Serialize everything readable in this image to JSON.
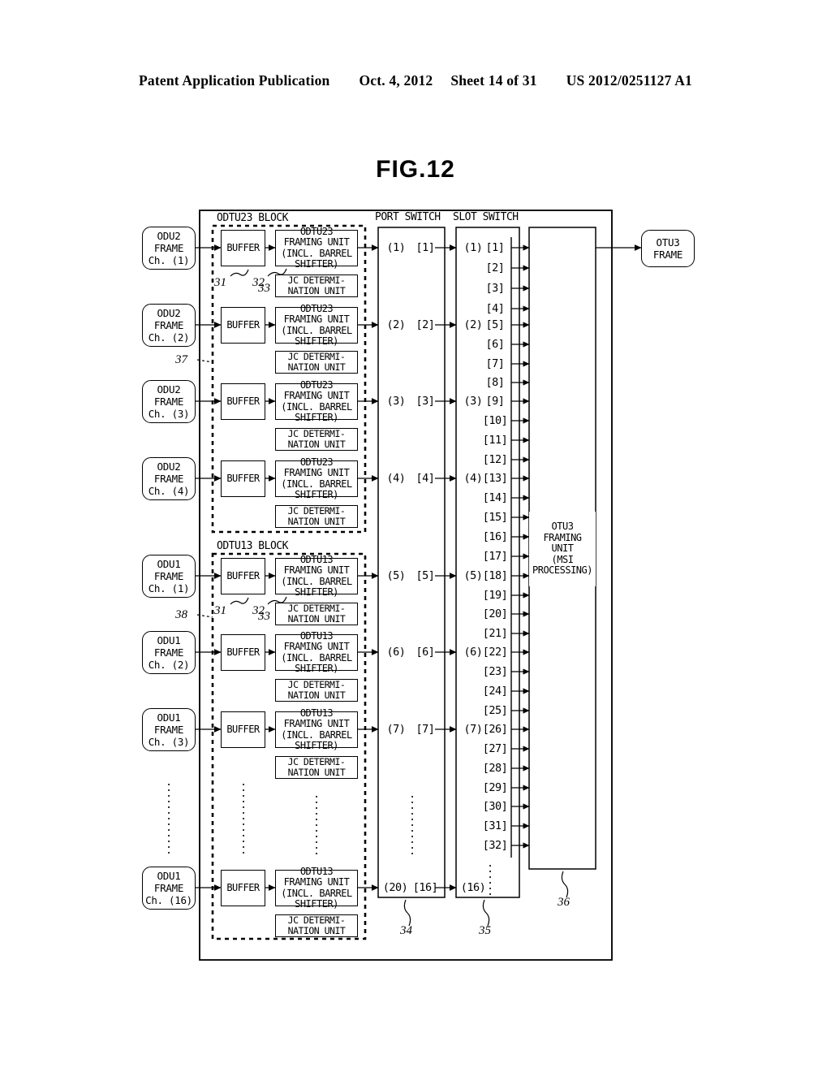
{
  "header": {
    "publication": "Patent Application Publication",
    "date": "Oct. 4, 2012",
    "sheet": "Sheet 14 of 31",
    "number": "US 2012/0251127 A1"
  },
  "figure": {
    "title": "FIG.12"
  },
  "columns": {
    "port_switch": "PORT SWITCH",
    "slot_switch": "SLOT SWITCH"
  },
  "blocks": {
    "odtu23": {
      "label": "ODTU23 BLOCK",
      "ref": "37"
    },
    "odtu13": {
      "label": "ODTU13 BLOCK",
      "ref": "38"
    }
  },
  "refs": {
    "buffer": "31",
    "framing": "32",
    "jc": "33",
    "port_switch": "34",
    "slot_switch": "35",
    "otu3_framing": "36"
  },
  "labels": {
    "buffer": "BUFFER",
    "jc_line1": "JC DETERMI-",
    "jc_line2": "NATION UNIT",
    "framing23_line1": "ODTU23",
    "framing23_line2": "FRAMING UNIT",
    "framing23_line3": "(INCL. BARREL",
    "framing23_line4": "SHIFTER)",
    "framing13_line1": "ODTU13",
    "framing13_line2": "FRAMING UNIT",
    "framing13_line3": "(INCL. BARREL",
    "framing13_line4": "SHIFTER)",
    "otu3_line1": "OTU3",
    "otu3_line2": "FRAMING",
    "otu3_line3": "UNIT",
    "otu3_line4": "(MSI",
    "otu3_line5": "PROCESSING)",
    "otu3_frame_line1": "OTU3",
    "otu3_frame_line2": "FRAME"
  },
  "inputs_odu2": [
    {
      "line1": "ODU2",
      "line2": "FRAME",
      "line3": "Ch. (1)"
    },
    {
      "line1": "ODU2",
      "line2": "FRAME",
      "line3": "Ch. (2)"
    },
    {
      "line1": "ODU2",
      "line2": "FRAME",
      "line3": "Ch. (3)"
    },
    {
      "line1": "ODU2",
      "line2": "FRAME",
      "line3": "Ch. (4)"
    }
  ],
  "inputs_odu1": [
    {
      "line1": "ODU1",
      "line2": "FRAME",
      "line3": "Ch. (1)"
    },
    {
      "line1": "ODU1",
      "line2": "FRAME",
      "line3": "Ch. (2)"
    },
    {
      "line1": "ODU1",
      "line2": "FRAME",
      "line3": "Ch. (3)"
    },
    {
      "line1": "ODU1",
      "line2": "FRAME",
      "line3": "Ch. (16)"
    }
  ],
  "port_in": [
    "(1)",
    "(2)",
    "(3)",
    "(4)",
    "(5)",
    "(6)",
    "(7)",
    "(20)"
  ],
  "port_out": [
    "[1]",
    "[2]",
    "[3]",
    "[4]",
    "[5]",
    "[6]",
    "[7]",
    "[16]"
  ],
  "slot_in": [
    "(1)",
    "(2)",
    "(3)",
    "(4)",
    "(5)",
    "(6)",
    "(7)",
    "(16)"
  ],
  "slot_out": [
    "[1]",
    "[2]",
    "[3]",
    "[4]",
    "[5]",
    "[6]",
    "[7]",
    "[8]",
    "[9]",
    "[10]",
    "[11]",
    "[12]",
    "[13]",
    "[14]",
    "[15]",
    "[16]",
    "[17]",
    "[18]",
    "[19]",
    "[20]",
    "[21]",
    "[22]",
    "[23]",
    "[24]",
    "[25]",
    "[26]",
    "[27]",
    "[28]",
    "[29]",
    "[30]",
    "[31]",
    "[32]"
  ],
  "ellipsis": "⋮",
  "colors": {
    "ink": "#000000",
    "paper": "#ffffff"
  }
}
